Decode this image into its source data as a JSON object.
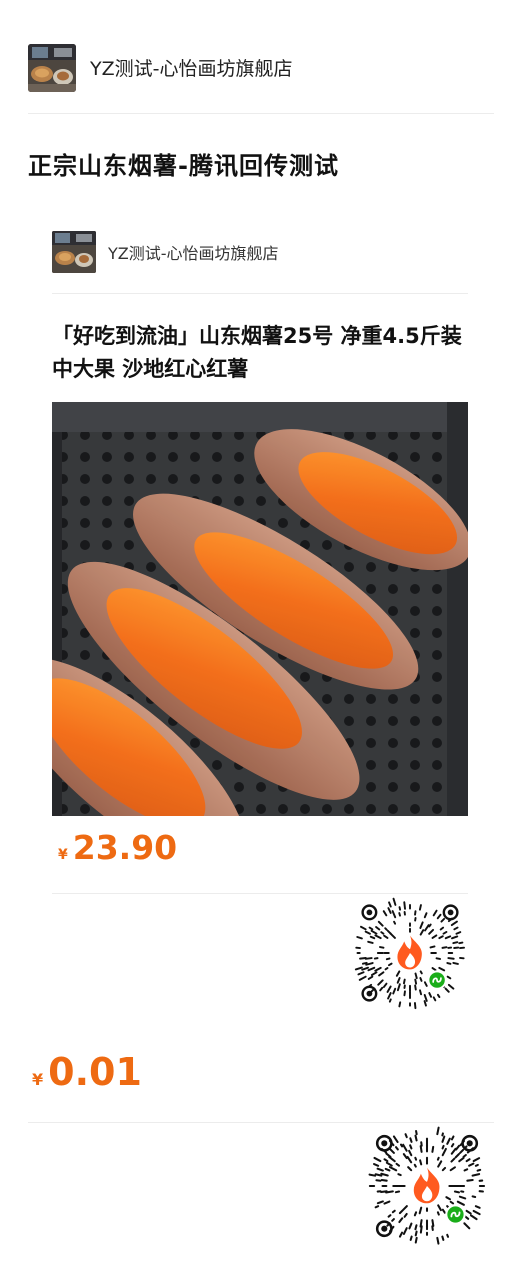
{
  "shop": {
    "name": "YZ测试-心怡画坊旗舰店"
  },
  "page": {
    "title": "正宗山东烟薯-腾讯回传测试"
  },
  "card": {
    "shop_name": "YZ测试-心怡画坊旗舰店",
    "product_title": "「好吃到流油」山东烟薯25号 净重4.5斤装 中大果 沙地红心红薯",
    "currency": "¥",
    "price": "23.90"
  },
  "main_price": {
    "currency": "¥",
    "price": "0.01"
  },
  "colors": {
    "accent": "#ee6a12",
    "qr_flame": "#ff5a1f",
    "miniprogram_badge": "#1aad19"
  },
  "icons": {
    "qr_code": "mini-program-code-icon",
    "flame": "flame-icon",
    "badge": "mini-program-badge-icon"
  }
}
